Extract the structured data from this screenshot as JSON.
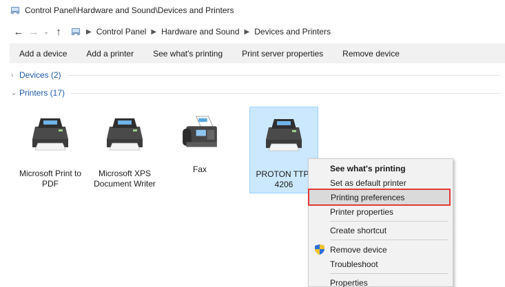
{
  "window": {
    "title": "Control Panel\\Hardware and Sound\\Devices and Printers"
  },
  "address": {
    "crumbs": [
      "Control Panel",
      "Hardware and Sound",
      "Devices and Printers"
    ]
  },
  "toolbar": {
    "buttons": [
      "Add a device",
      "Add a printer",
      "See what's printing",
      "Print server properties",
      "Remove device"
    ]
  },
  "groups": {
    "devices": "Devices (2)",
    "printers": "Printers (17)"
  },
  "printers": [
    {
      "label": "Microsoft Print to PDF",
      "icon": "printer-icon"
    },
    {
      "label": "Microsoft XPS Document Writer",
      "icon": "printer-icon"
    },
    {
      "label": "Fax",
      "icon": "fax-icon"
    },
    {
      "label": "PROTON TTP-4206",
      "icon": "printer-icon"
    }
  ],
  "context_menu": {
    "items": [
      "See what's printing",
      "Set as default printer",
      "Printing preferences",
      "Printer properties",
      "Create shortcut",
      "Remove device",
      "Troubleshoot",
      "Properties"
    ]
  },
  "colors": {
    "selection_bg": "#cce8ff",
    "highlight_border": "#e23838",
    "link_blue": "#1e5aa8"
  }
}
